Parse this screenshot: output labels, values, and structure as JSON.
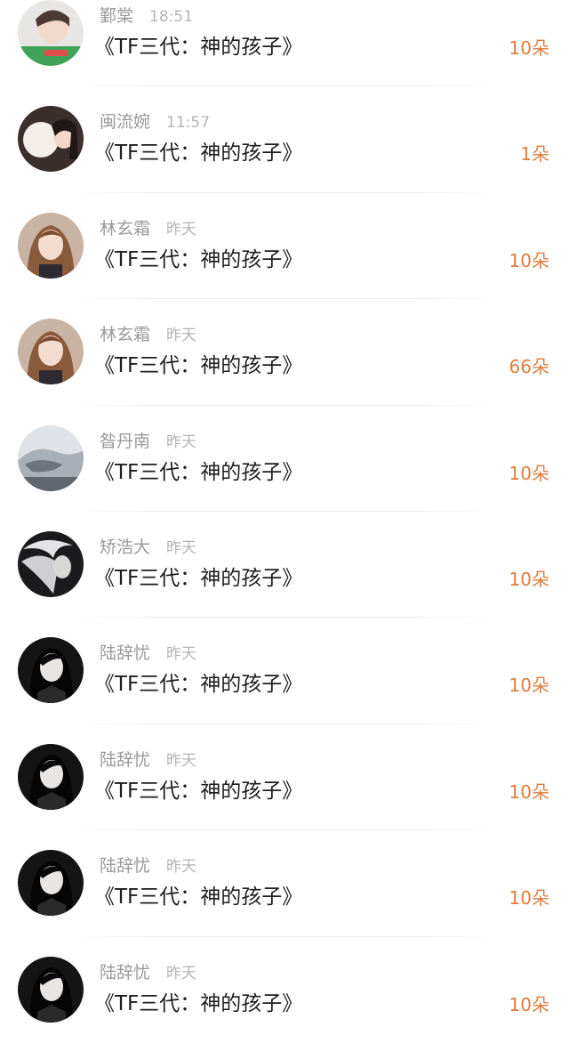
{
  "gift_list": {
    "items": [
      {
        "user": "鄞棠",
        "time": "18:51",
        "work": "《TF三代：神的孩子》",
        "gift": "10朵",
        "avatar_icon": "avatar-photo-girl-selfie"
      },
      {
        "user": "闽流婉",
        "time": "11:57",
        "work": "《TF三代：神的孩子》",
        "gift": "1朵",
        "avatar_icon": "avatar-photo-girl-balloon"
      },
      {
        "user": "林玄霜",
        "time": "昨天",
        "work": "《TF三代：神的孩子》",
        "gift": "10朵",
        "avatar_icon": "avatar-photo-girl-brown-hair"
      },
      {
        "user": "林玄霜",
        "time": "昨天",
        "work": "《TF三代：神的孩子》",
        "gift": "66朵",
        "avatar_icon": "avatar-photo-girl-brown-hair"
      },
      {
        "user": "昝丹南",
        "time": "昨天",
        "work": "《TF三代：神的孩子》",
        "gift": "10朵",
        "avatar_icon": "avatar-anime-gray-sleeping"
      },
      {
        "user": "矫浩大",
        "time": "昨天",
        "work": "《TF三代：神的孩子》",
        "gift": "10朵",
        "avatar_icon": "avatar-anime-white-hair-dark"
      },
      {
        "user": "陆辞忧",
        "time": "昨天",
        "work": "《TF三代：神的孩子》",
        "gift": "10朵",
        "avatar_icon": "avatar-photo-girl-monochrome"
      },
      {
        "user": "陆辞忧",
        "time": "昨天",
        "work": "《TF三代：神的孩子》",
        "gift": "10朵",
        "avatar_icon": "avatar-photo-girl-monochrome"
      },
      {
        "user": "陆辞忧",
        "time": "昨天",
        "work": "《TF三代：神的孩子》",
        "gift": "10朵",
        "avatar_icon": "avatar-photo-girl-monochrome"
      },
      {
        "user": "陆辞忧",
        "time": "昨天",
        "work": "《TF三代：神的孩子》",
        "gift": "10朵",
        "avatar_icon": "avatar-photo-girl-monochrome"
      }
    ]
  },
  "colors": {
    "gift_accent": "#e07d3e",
    "name_gray": "#9a9a9a",
    "title_text": "#1e1e1e"
  }
}
